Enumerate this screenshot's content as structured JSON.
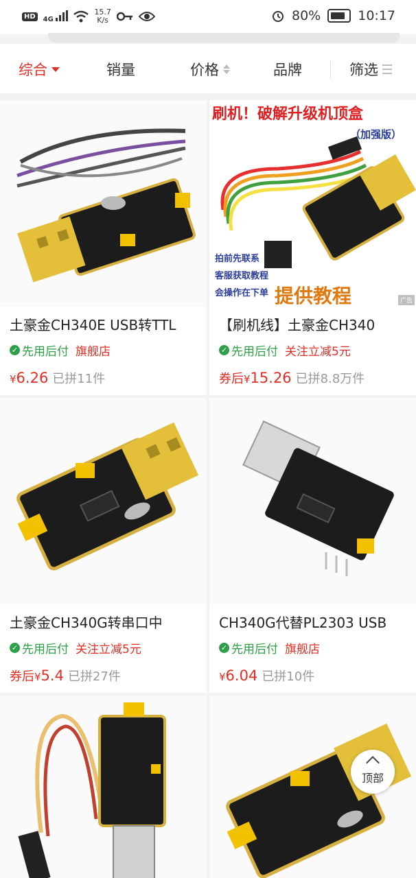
{
  "status_bar": {
    "badge_hd": "HD",
    "badge_4g": "4G",
    "net_speed_value": "15.7",
    "net_speed_unit": "K/s",
    "battery": "80%",
    "time": "10:17"
  },
  "filter_bar": {
    "tabs": [
      "综合",
      "销量",
      "价格",
      "品牌",
      "筛选"
    ],
    "active_tab": "综合"
  },
  "products": [
    {
      "title": "土豪金CH340E USB转TTL",
      "tag_green": "先用后付",
      "tag_red": "旗舰店",
      "price_prefix": "",
      "price_symbol": "¥",
      "price": "6.26",
      "sold": "已拼11件",
      "image_text": []
    },
    {
      "title": "【刷机线】土豪金CH340",
      "tag_green": "先用后付",
      "tag_red": "关注立减5元",
      "price_prefix": "券后",
      "price_symbol": "¥",
      "price": "15.26",
      "sold": "已拼8.8万件",
      "ad_label": "广告",
      "image_text": [
        "刷机！破解升级机顶盒",
        "（加强版）",
        "拍前先联系",
        "客服获取教程",
        "会操作在下单",
        "提供教程"
      ]
    },
    {
      "title": "土豪金CH340G转串口中",
      "tag_green": "先用后付",
      "tag_red": "关注立减5元",
      "price_prefix": "券后",
      "price_symbol": "¥",
      "price": "5.4",
      "sold": "已拼27件",
      "image_text": []
    },
    {
      "title": "CH340G代替PL2303 USB",
      "tag_green": "先用后付",
      "tag_red": "旗舰店",
      "price_prefix": "",
      "price_symbol": "¥",
      "price": "6.04",
      "sold": "已拼10件",
      "image_text": []
    },
    {
      "title": "",
      "image_text": []
    },
    {
      "title": "",
      "image_text": []
    }
  ],
  "back_to_top": "顶部",
  "colors": {
    "accent": "#e02e24",
    "green": "#2e9e48",
    "background": "#f2f2f2"
  }
}
